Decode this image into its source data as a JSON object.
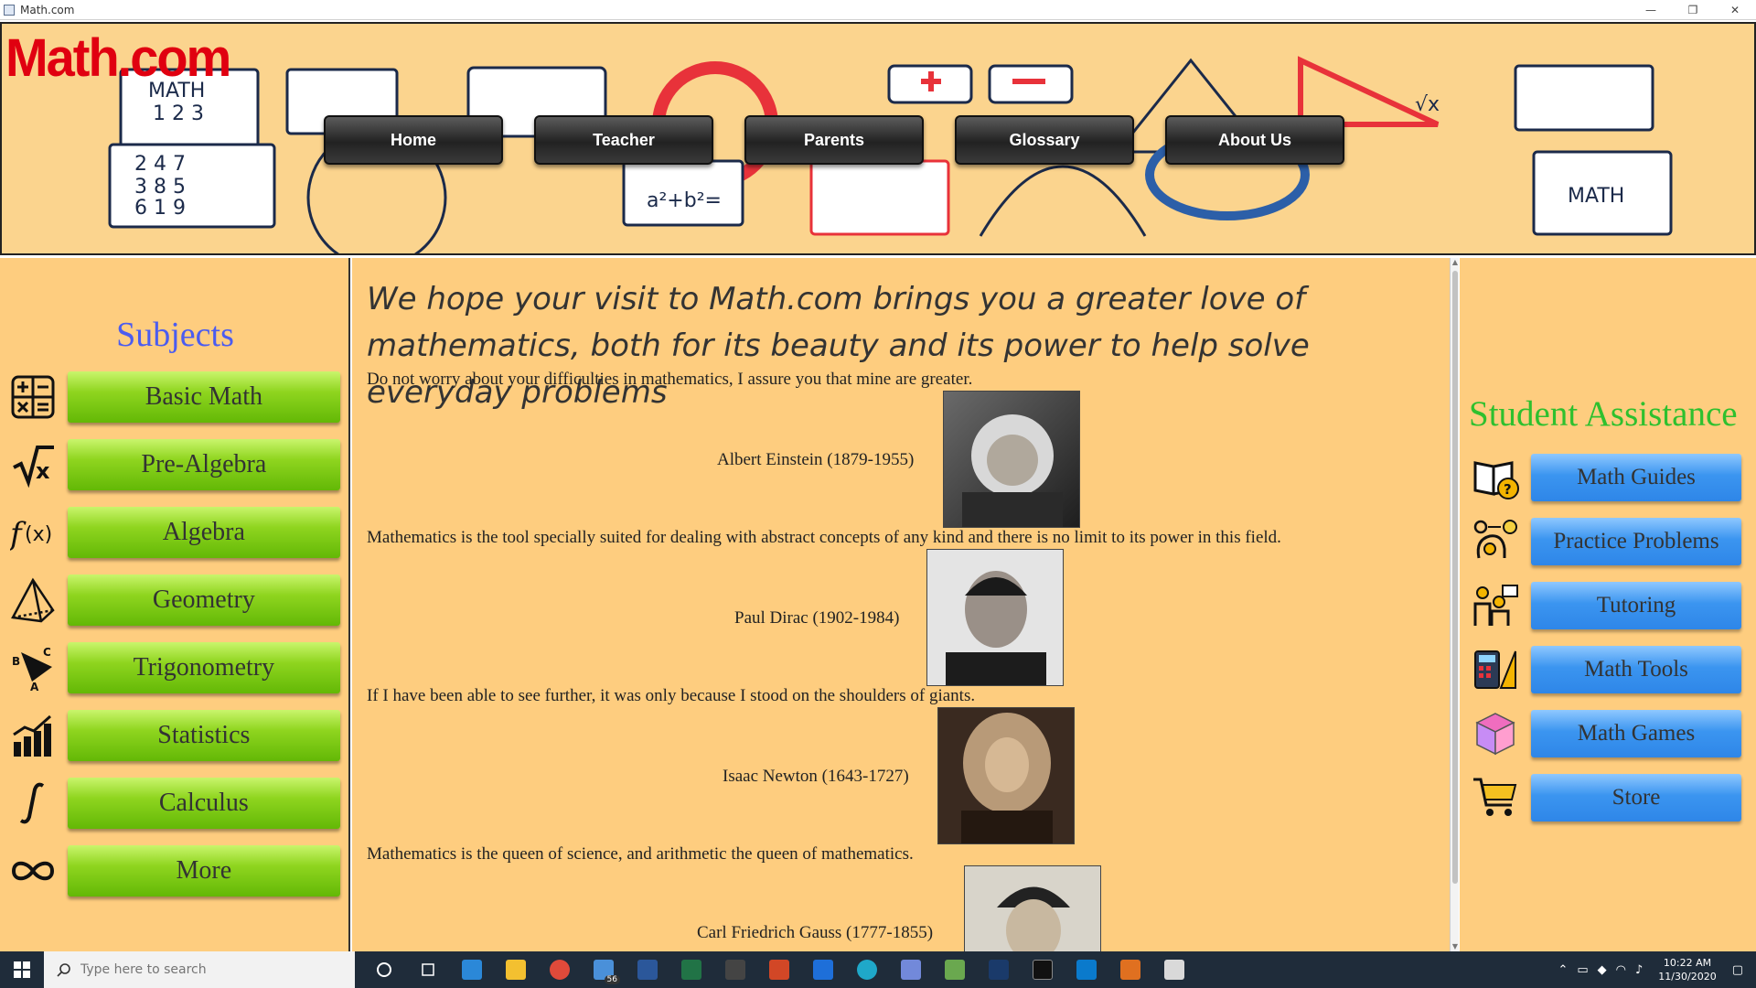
{
  "window": {
    "title": "Math.com",
    "min": "—",
    "restore": "❐",
    "close": "✕"
  },
  "banner": {
    "logo": "Math.com",
    "nav": [
      {
        "label": "Home"
      },
      {
        "label": "Teacher"
      },
      {
        "label": "Parents"
      },
      {
        "label": "Glossary"
      },
      {
        "label": "About Us"
      }
    ]
  },
  "subjects": {
    "title": "Subjects",
    "items": [
      {
        "label": "Basic Math",
        "icon": "operators-icon"
      },
      {
        "label": "Pre-Algebra",
        "icon": "square-root-icon"
      },
      {
        "label": "Algebra",
        "icon": "function-icon"
      },
      {
        "label": "Geometry",
        "icon": "pyramid-icon"
      },
      {
        "label": "Trigonometry",
        "icon": "triangle-abc-icon"
      },
      {
        "label": "Statistics",
        "icon": "bar-chart-icon"
      },
      {
        "label": "Calculus",
        "icon": "integral-icon"
      },
      {
        "label": "More",
        "icon": "infinity-icon"
      }
    ]
  },
  "main": {
    "headline": "We hope your visit to Math.com brings you a greater love of mathematics, both for its beauty and its power to help solve everyday problems",
    "quotes": [
      {
        "text": "Do not worry about your difficulties in mathematics, I assure you that mine are greater.",
        "author": "Albert Einstein (1879-1955)"
      },
      {
        "text": "Mathematics is the tool specially suited for dealing with abstract concepts of any kind and there is no limit to its power in this field.",
        "author": "Paul Dirac (1902-1984)"
      },
      {
        "text": "If I have been able to see further, it was only because I stood on the shoulders of giants.",
        "author": "Isaac Newton (1643-1727)"
      },
      {
        "text": "Mathematics is the queen of science, and arithmetic the queen of mathematics.",
        "author": "Carl Friedrich Gauss (1777-1855)"
      }
    ]
  },
  "assistance": {
    "title": "Student Assistance",
    "items": [
      {
        "label": "Math Guides",
        "icon": "book-question-icon"
      },
      {
        "label": "Practice Problems",
        "icon": "brain-gears-icon"
      },
      {
        "label": "Tutoring",
        "icon": "tutor-icon"
      },
      {
        "label": "Math Tools",
        "icon": "calculator-ruler-icon"
      },
      {
        "label": "Math Games",
        "icon": "rubiks-cube-icon"
      },
      {
        "label": "Store",
        "icon": "shopping-cart-icon"
      }
    ]
  },
  "taskbar": {
    "search_placeholder": "Type here to search",
    "mail_badge": "56",
    "time": "10:22 AM",
    "date": "11/30/2020"
  }
}
